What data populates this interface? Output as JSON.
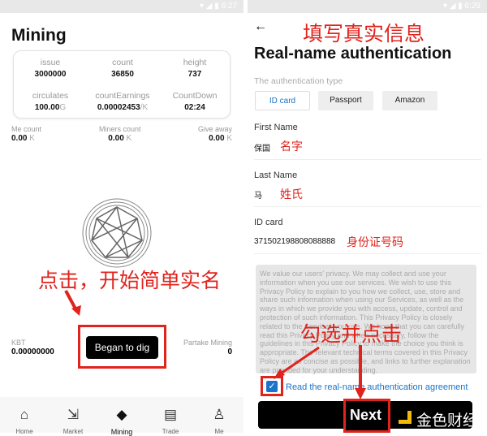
{
  "left": {
    "status_time": "6:27",
    "title": "Mining",
    "card": [
      {
        "k": "issue",
        "v": "3000000",
        "u": ""
      },
      {
        "k": "count",
        "v": "36850",
        "u": ""
      },
      {
        "k": "height",
        "v": "737",
        "u": ""
      },
      {
        "k": "circulates",
        "v": "100.00",
        "u": "G"
      },
      {
        "k": "countEarnings",
        "v": "0.00002453",
        "u": "/K"
      },
      {
        "k": "CountDown",
        "v": "02:24",
        "u": ""
      }
    ],
    "stats": [
      {
        "k": "Me count",
        "v": "0.00",
        "u": "K"
      },
      {
        "k": "Miners count",
        "v": "0.00",
        "u": "K"
      },
      {
        "k": "Give away",
        "v": "0.00",
        "u": "K"
      }
    ],
    "annotation": "点击，开始简单实名",
    "kbt_label": "KBT",
    "kbt_value": "0.00000000",
    "dig_button": "Began to dig",
    "partake_label": "Partake Mining",
    "partake_value": "0",
    "nav": [
      {
        "icon": "home-icon",
        "g": "⌂",
        "label": "Home"
      },
      {
        "icon": "market-icon",
        "g": "⇲",
        "label": "Market"
      },
      {
        "icon": "mining-icon",
        "g": "◆",
        "label": "Mining"
      },
      {
        "icon": "trade-icon",
        "g": "▤",
        "label": "Trade"
      },
      {
        "icon": "me-icon",
        "g": "♙",
        "label": "Me"
      }
    ]
  },
  "right": {
    "status_time": "6:29",
    "annotation_top": "填写真实信息",
    "title": "Real-name authentication",
    "auth_type_label": "The authentication type",
    "tabs": [
      "ID card",
      "Passport",
      "Amazon"
    ],
    "first_name_label": "First Name",
    "first_name_value": "保国",
    "first_name_note": "名字",
    "last_name_label": "Last Name",
    "last_name_value": "马",
    "last_name_note": "姓氏",
    "id_label": "ID card",
    "id_value": "371502198808088888",
    "id_note": "身份证号码",
    "policy": "We value our users' privacy. We may collect and use your information when you use our services. We wish to use this Privacy Policy to explain to you how we collect, use, store and share such information when using our Services, as well as the ways in which we provide you with access, update, control and protection of such information. This Privacy Policy is closely related to the Services you use. We hope that you can carefully read this Privacy Policy and when necessary, follow the guidelines in this Privacy Policy to make the choice you think is appropriate. The relevant technical terms covered in this Privacy Policy are as concise as possible, and links to further explanation are provided for your understanding.",
    "annotation_check": "勾选并点击",
    "agreement": "Read the real-name authentication agreement",
    "next_button": "Next",
    "watermark": "金色财经"
  },
  "colors": {
    "accent": "#1a73c8",
    "annotation": "#e0231c"
  }
}
